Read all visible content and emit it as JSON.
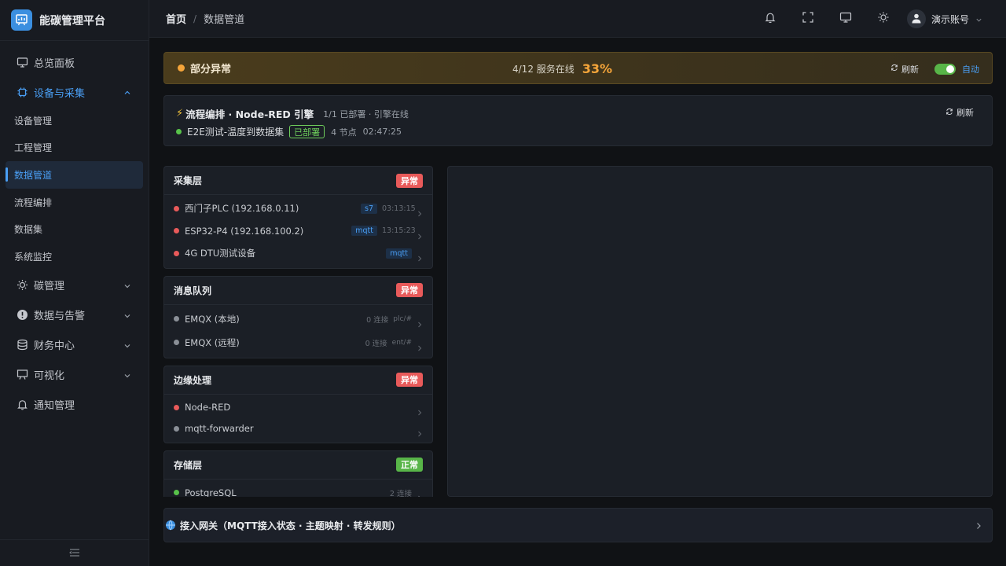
{
  "app": {
    "name": "能碳管理平台"
  },
  "sidebar": {
    "items": [
      {
        "label": "总览面板",
        "icon": "monitor-icon"
      },
      {
        "label": "设备与采集",
        "icon": "chip-icon",
        "expanded": true,
        "children": [
          {
            "label": "设备管理"
          },
          {
            "label": "工程管理"
          },
          {
            "label": "数据管道",
            "selected": true
          },
          {
            "label": "流程编排"
          },
          {
            "label": "数据集"
          },
          {
            "label": "系统监控"
          }
        ]
      },
      {
        "label": "碳管理",
        "icon": "sun-icon"
      },
      {
        "label": "数据与告警",
        "icon": "alert-icon"
      },
      {
        "label": "财务中心",
        "icon": "database-icon"
      },
      {
        "label": "可视化",
        "icon": "presentation-icon"
      },
      {
        "label": "通知管理",
        "icon": "bell-icon"
      }
    ]
  },
  "header": {
    "breadcrumb": {
      "home": "首页",
      "separator": "/",
      "current": "数据管道"
    },
    "account": {
      "name": "演示账号"
    }
  },
  "status": {
    "title": "部分异常",
    "online_count": "4/12 服务在线",
    "percent": "33%",
    "refresh_label": "刷新",
    "auto_label": "自动",
    "auto_enabled": true,
    "color": "#f5a53a"
  },
  "flow": {
    "title": "流程编排 · Node-RED 引擎",
    "meta": "1/1 已部署 · 引擎在线",
    "refresh_label": "刷新",
    "item": {
      "name": "E2E测试-温度到数据集",
      "tag": "已部署",
      "nodes": "4 节点",
      "time": "02:47:25"
    }
  },
  "layers": [
    {
      "title": "采集层",
      "status": "异常",
      "rows": [
        {
          "name": "西门子PLC (192.168.0.11)",
          "tag": "s7",
          "time": "03:13:15"
        },
        {
          "name": "ESP32-P4 (192.168.100.2)",
          "tag": "mqtt",
          "time": "13:15:23"
        },
        {
          "name": "4G DTU测试设备",
          "tag": "mqtt",
          "time": ""
        }
      ]
    },
    {
      "title": "消息队列",
      "status": "异常",
      "rows": [
        {
          "name": "EMQX (本地)",
          "conn": "0 连接",
          "topic": "plc/#"
        },
        {
          "name": "EMQX (远程)",
          "conn": "0 连接",
          "topic": "ent/#"
        }
      ]
    },
    {
      "title": "边缘处理",
      "status": "异常",
      "rows": [
        {
          "name": "Node-RED"
        },
        {
          "name": "mqtt-forwarder"
        }
      ]
    },
    {
      "title": "存储层",
      "status": "正常",
      "rows": [
        {
          "name": "PostgreSQL",
          "conn": "2 连接"
        }
      ]
    }
  ],
  "gateway": {
    "title": "接入网关（MQTT接入状态 · 主题映射 · 转发规则）"
  }
}
